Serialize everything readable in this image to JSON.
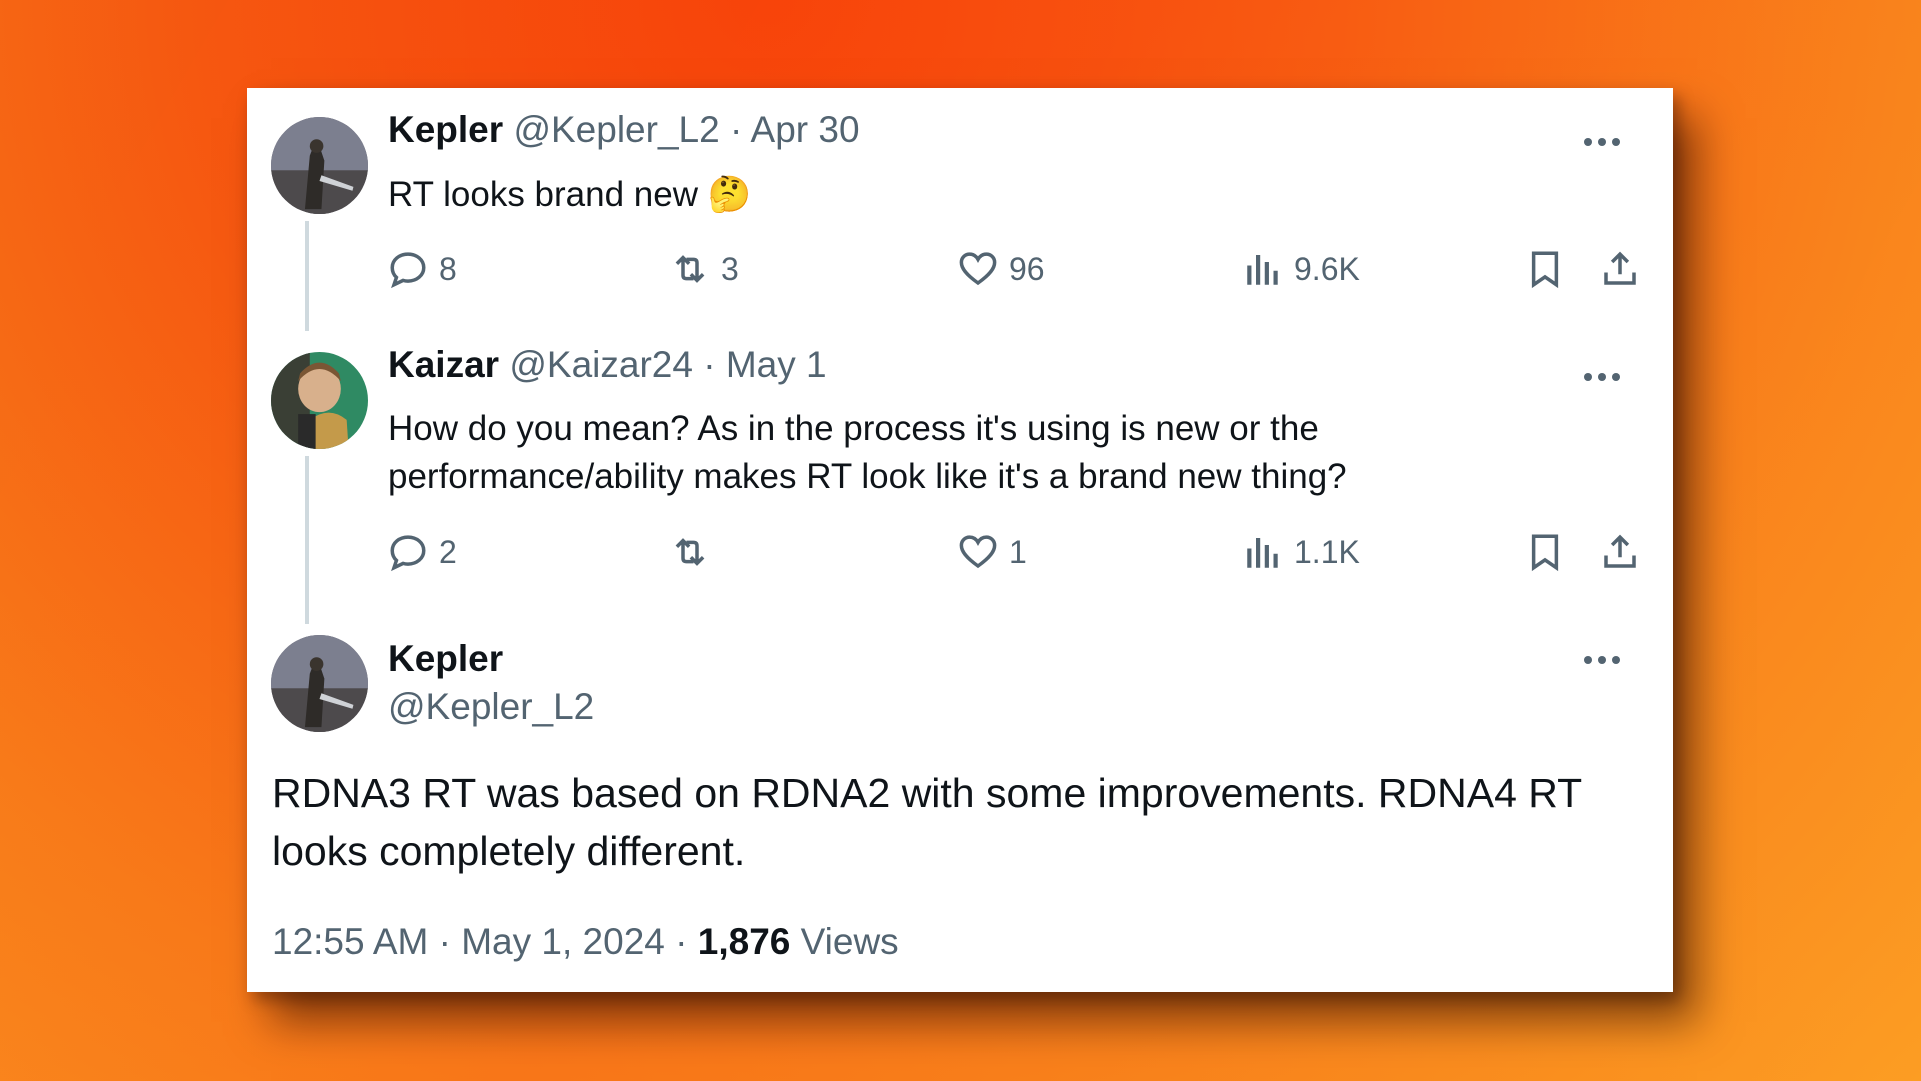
{
  "tweets": [
    {
      "name": "Kepler",
      "handle": "@Kepler_L2",
      "sep": "·",
      "date": "Apr 30",
      "text": "RT looks brand new 🤔",
      "replies": "8",
      "retweets": "3",
      "likes": "96",
      "views": "9.6K"
    },
    {
      "name": "Kaizar",
      "handle": "@Kaizar24",
      "sep": "·",
      "date": "May 1",
      "text_line1": "How do you mean? As in the process it's using is new or the",
      "text_line2": "performance/ability makes RT look like it's a brand new thing?",
      "replies": "2",
      "retweets": "",
      "likes": "1",
      "views": "1.1K"
    }
  ],
  "main_tweet": {
    "name": "Kepler",
    "handle": "@Kepler_L2",
    "text_line1": "RDNA3 RT was based on RDNA2 with some improvements. RDNA4 RT",
    "text_line2": "looks completely different.",
    "time": "12:55 AM",
    "sep": "·",
    "date": "May 1, 2024",
    "views_count": "1,876",
    "views_label": "Views"
  },
  "icons": {
    "reply": "reply-icon",
    "retweet": "retweet-icon",
    "like": "heart-icon",
    "views": "views-chart-icon",
    "bookmark": "bookmark-icon",
    "share": "share-icon",
    "more": "more-dots-icon"
  },
  "colors": {
    "text_primary": "#0f1419",
    "text_secondary": "#536471",
    "thread_line": "#cfd9de",
    "bg_orange": "#f55710"
  }
}
